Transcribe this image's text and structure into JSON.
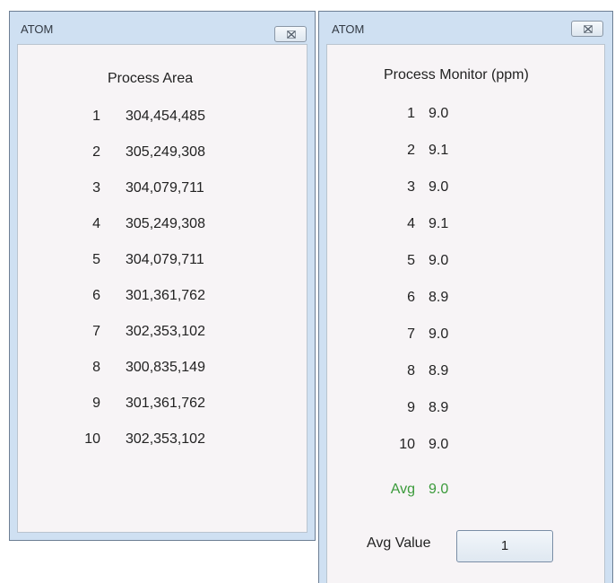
{
  "left_window": {
    "title": "ATOM",
    "heading": "Process  Area",
    "rows": [
      {
        "index": "1",
        "value": "304,454,485"
      },
      {
        "index": "2",
        "value": "305,249,308"
      },
      {
        "index": "3",
        "value": "304,079,711"
      },
      {
        "index": "4",
        "value": "305,249,308"
      },
      {
        "index": "5",
        "value": "304,079,711"
      },
      {
        "index": "6",
        "value": "301,361,762"
      },
      {
        "index": "7",
        "value": "302,353,102"
      },
      {
        "index": "8",
        "value": "300,835,149"
      },
      {
        "index": "9",
        "value": "301,361,762"
      },
      {
        "index": "10",
        "value": "302,353,102"
      }
    ]
  },
  "right_window": {
    "title": "ATOM",
    "heading": "Process Monitor (ppm)",
    "rows": [
      {
        "index": "1",
        "value": "9.0"
      },
      {
        "index": "2",
        "value": "9.1"
      },
      {
        "index": "3",
        "value": "9.0"
      },
      {
        "index": "4",
        "value": "9.1"
      },
      {
        "index": "5",
        "value": "9.0"
      },
      {
        "index": "6",
        "value": "8.9"
      },
      {
        "index": "7",
        "value": "9.0"
      },
      {
        "index": "8",
        "value": "8.9"
      },
      {
        "index": "9",
        "value": "8.9"
      },
      {
        "index": "10",
        "value": "9.0"
      }
    ],
    "avg_label": "Avg",
    "avg_value": "9.0",
    "avg_value_label": "Avg Value",
    "avg_value_input": "1"
  },
  "colors": {
    "frame": "#cfe0f2",
    "client": "#f7f4f6",
    "avg_green": "#3a9a3a"
  },
  "icons": {
    "close": "close-icon"
  }
}
